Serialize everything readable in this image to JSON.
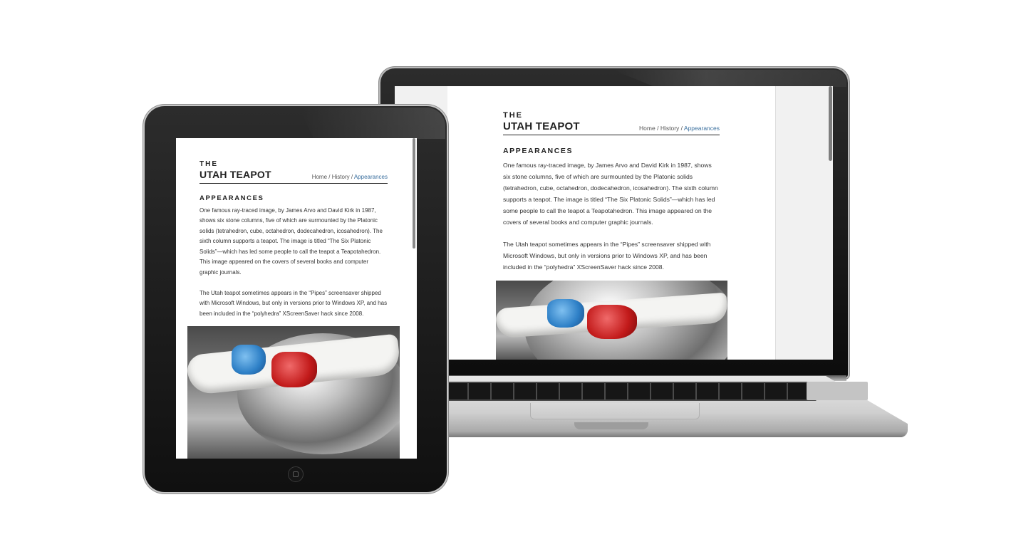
{
  "site": {
    "brand_the": "THE",
    "brand_name": "UTAH TEAPOT",
    "breadcrumb": {
      "home": "Home",
      "sep1": " / ",
      "history": "History",
      "sep2": " / ",
      "current": "Appearances"
    },
    "section_title": "APPEARANCES",
    "paragraphs": [
      "One famous ray-traced image, by James Arvo and David Kirk in 1987, shows six stone columns, five of which are surmounted by the Platonic solids (tetrahedron, cube, octahedron, dodecahedron, icosahedron). The sixth column supports a teapot. The image is titled “The Six Platonic Solids”—which has led some people to call the teapot a Teapotahedron. This image appeared on the covers of several books and computer graphic journals.",
      "The Utah teapot sometimes appears in the “Pipes” screensaver shipped with Microsoft Windows, but only in versions prior to Windows XP, and has been included in the “polyhedra” XScreenSaver hack since 2008."
    ],
    "photo_subject": "teapot-with-3d-glasses"
  },
  "colors": {
    "breadcrumb_current": "#3a6f9e",
    "text": "#222222",
    "device_bezel": "#111111"
  }
}
